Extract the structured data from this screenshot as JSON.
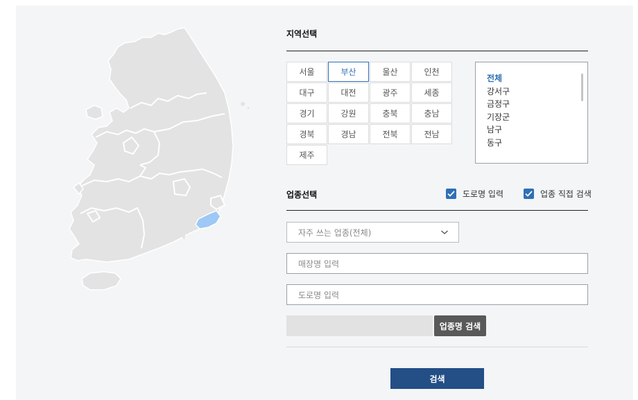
{
  "region_section": {
    "title": "지역선택",
    "regions": [
      "서울",
      "부산",
      "울산",
      "인천",
      "대구",
      "대전",
      "광주",
      "세종",
      "경기",
      "강원",
      "충북",
      "충남",
      "경북",
      "경남",
      "전북",
      "전남",
      "제주"
    ],
    "selected_region": "부산"
  },
  "districts": {
    "items": [
      "전체",
      "강서구",
      "금정구",
      "기장군",
      "남구",
      "동구"
    ],
    "selected": "전체"
  },
  "business_section": {
    "title": "업종선택",
    "road_name_input_label": "도로명 입력",
    "direct_search_label": "업종 직접 검색"
  },
  "form": {
    "category_select_value": "자주 쓰는 업종(전체)",
    "store_name_placeholder": "매장명 입력",
    "road_name_placeholder": "도로명 입력",
    "business_search_button": "업종명 검색",
    "search_button": "검색"
  },
  "colors": {
    "accent": "#2f6fb5",
    "map_fill": "#e3e3e3",
    "map_highlight": "#9ec8f5",
    "search_button_bg": "#234e86"
  }
}
